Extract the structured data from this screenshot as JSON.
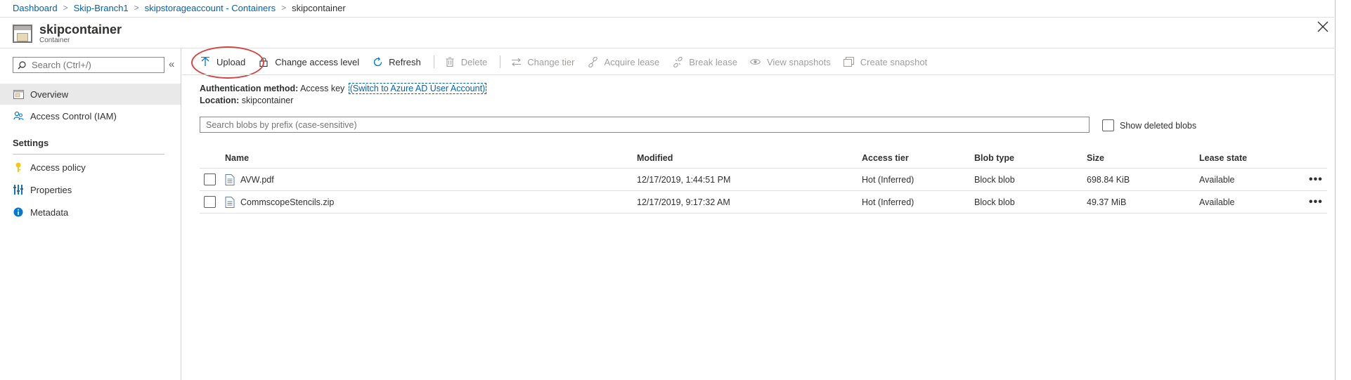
{
  "breadcrumb": {
    "items": [
      "Dashboard",
      "Skip-Branch1",
      "skipstorageaccount - Containers"
    ],
    "current": "skipcontainer"
  },
  "header": {
    "title": "skipcontainer",
    "subtitle": "Container",
    "close_icon": "close-icon"
  },
  "sidebar": {
    "search_placeholder": "Search (Ctrl+/)",
    "collapse_glyph": "«",
    "items": [
      {
        "label": "Overview",
        "icon": "overview-icon",
        "selected": true
      },
      {
        "label": "Access Control (IAM)",
        "icon": "people-icon"
      }
    ],
    "section_label": "Settings",
    "settings_items": [
      {
        "label": "Access policy",
        "icon": "key-icon"
      },
      {
        "label": "Properties",
        "icon": "properties-icon"
      },
      {
        "label": "Metadata",
        "icon": "info-icon"
      }
    ]
  },
  "toolbar": {
    "upload": "Upload",
    "change_access": "Change access level",
    "refresh": "Refresh",
    "delete": "Delete",
    "change_tier": "Change tier",
    "acquire_lease": "Acquire lease",
    "break_lease": "Break lease",
    "view_snapshots": "View snapshots",
    "create_snapshot": "Create snapshot"
  },
  "info": {
    "auth_label": "Authentication method:",
    "auth_value": "Access key",
    "auth_link": "(Switch to Azure AD User Account)",
    "location_label": "Location:",
    "location_value": "skipcontainer"
  },
  "blob_search": {
    "placeholder": "Search blobs by prefix (case-sensitive)",
    "show_deleted_label": "Show deleted blobs"
  },
  "table": {
    "columns": [
      "Name",
      "Modified",
      "Access tier",
      "Blob type",
      "Size",
      "Lease state"
    ],
    "rows": [
      {
        "name": "AVW.pdf",
        "modified": "12/17/2019, 1:44:51 PM",
        "tier": "Hot (Inferred)",
        "type": "Block blob",
        "size": "698.84 KiB",
        "lease": "Available",
        "more": "•••"
      },
      {
        "name": "CommscopeStencils.zip",
        "modified": "12/17/2019, 9:17:32 AM",
        "tier": "Hot (Inferred)",
        "type": "Block blob",
        "size": "49.37 MiB",
        "lease": "Available",
        "more": "•••"
      }
    ]
  },
  "colors": {
    "link": "#0063b1",
    "highlight_circle": "#d64545",
    "selected_nav": "#e9e9e9",
    "disabled_text": "#a19f9d"
  }
}
